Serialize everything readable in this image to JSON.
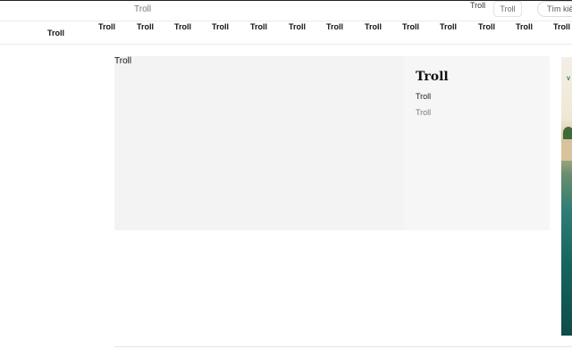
{
  "topbar": {
    "crumb": "Troll",
    "right_link": "Troll",
    "pill_button": "Troll",
    "search_placeholder": "Tìm kiế"
  },
  "nav": {
    "home": "Troll",
    "items": [
      "Troll",
      "Troll",
      "Troll",
      "Troll",
      "Troll",
      "Troll",
      "Troll",
      "Troll",
      "Troll",
      "Troll",
      "Troll",
      "Troll",
      "Troll"
    ]
  },
  "feature": {
    "media_label": "Troll",
    "title": "Troll",
    "line1": "Troll",
    "line2": "Troll"
  },
  "ad": {
    "initial": "V"
  }
}
